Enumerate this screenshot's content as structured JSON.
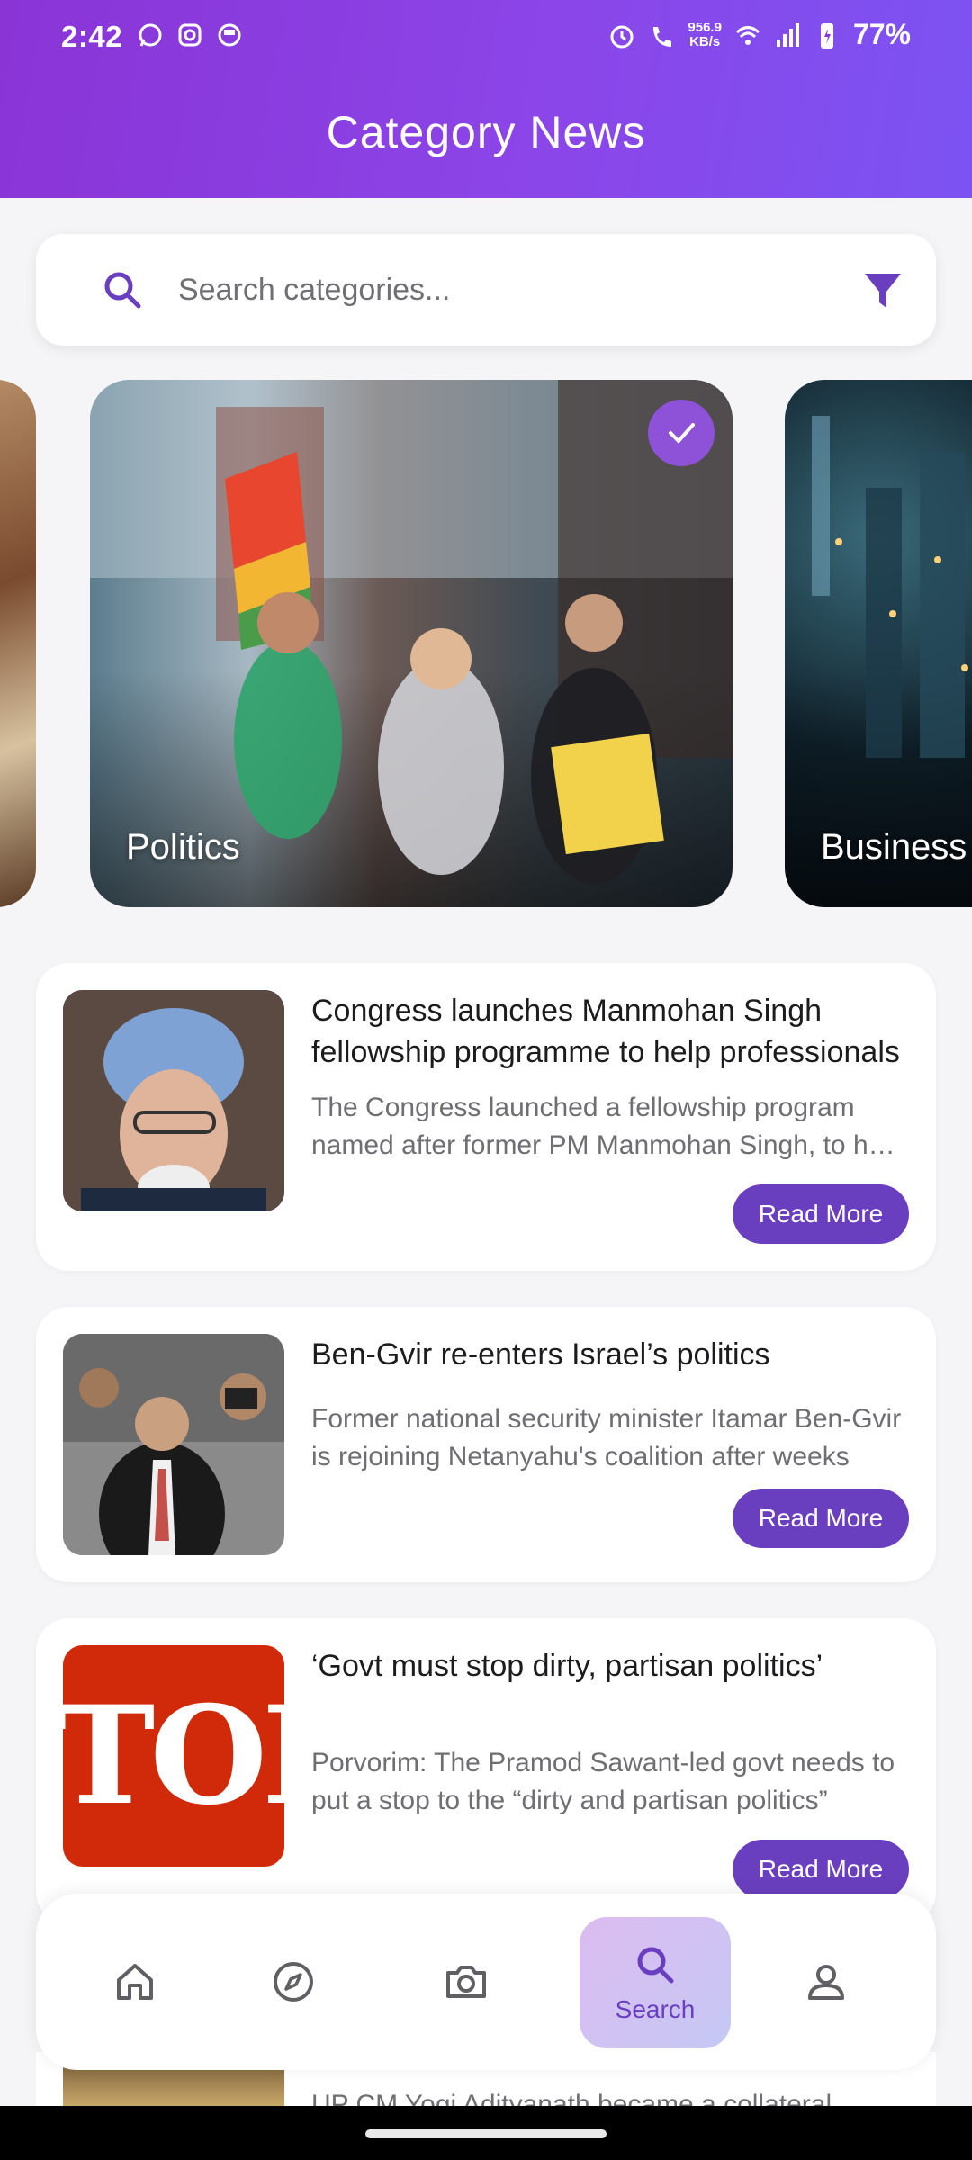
{
  "status_bar": {
    "time": "2:42",
    "net_speed_value": "956.9",
    "net_speed_unit": "KB/s",
    "battery": "77%"
  },
  "header": {
    "title": "Category News"
  },
  "search": {
    "placeholder": "Search categories..."
  },
  "categories": [
    {
      "label": "",
      "selected": false
    },
    {
      "label": "Politics",
      "selected": true
    },
    {
      "label": "Business",
      "selected": false
    }
  ],
  "news": [
    {
      "title": "Congress launches Manmohan Singh fellowship programme to help professionals",
      "description": "The Congress launched a fellowship program named after former PM Manmohan Singh, to help professionals",
      "button": "Read More"
    },
    {
      "title": "Ben-Gvir re-enters Israel’s politics",
      "description": "Former national security minister Itamar Ben-Gvir is rejoining Netanyahu's coalition after weeks",
      "button": "Read More"
    },
    {
      "title": "‘Govt must stop dirty, partisan politics’",
      "description": "Porvorim: The Pramod Sawant-led govt needs to put a stop to the “dirty and partisan politics”",
      "button": "Read More",
      "thumb_text": "TOI"
    }
  ],
  "partial_news": {
    "description": "UP CM Yogi Adityanath became a collateral"
  },
  "bottom_nav": {
    "items": [
      {
        "icon": "home-icon"
      },
      {
        "icon": "compass-icon"
      },
      {
        "icon": "camera-icon"
      },
      {
        "icon": "search-icon",
        "label": "Search",
        "active": true
      },
      {
        "icon": "profile-icon"
      }
    ]
  },
  "colors": {
    "accent": "#6a3fbf",
    "header_gradient_start": "#8a34d6",
    "header_gradient_end": "#7c53f2"
  }
}
